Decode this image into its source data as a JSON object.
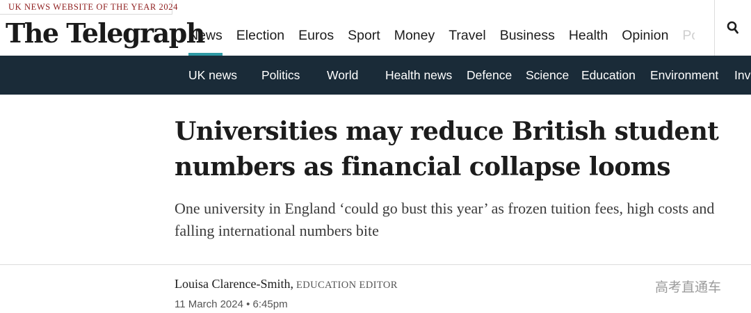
{
  "award_banner": "UK NEWS WEBSITE OF THE YEAR 2024",
  "masthead": "The Telegraph",
  "primary_nav": {
    "items": [
      {
        "label": "News",
        "active": true
      },
      {
        "label": "Election"
      },
      {
        "label": "Euros"
      },
      {
        "label": "Sport"
      },
      {
        "label": "Money"
      },
      {
        "label": "Travel"
      },
      {
        "label": "Business"
      },
      {
        "label": "Health"
      },
      {
        "label": "Opinion"
      },
      {
        "label": "Po"
      }
    ],
    "search_icon": "search-icon"
  },
  "secondary_nav": {
    "items": [
      {
        "label": "UK news"
      },
      {
        "label": "Politics"
      },
      {
        "label": "World"
      },
      {
        "label": "Health news"
      },
      {
        "label": "Defence"
      },
      {
        "label": "Science"
      },
      {
        "label": "Education"
      },
      {
        "label": "Environment"
      },
      {
        "label": "Inv"
      }
    ]
  },
  "article": {
    "headline": "Universities may reduce British student numbers as financial collapse looms",
    "standfirst": "One university in England ‘could go bust this year’ as frozen tuition fees, high costs and falling international numbers bite",
    "author": "Louisa Clarence-Smith,",
    "author_role": "Education Editor",
    "date": "11 March 2024 • 6:45pm"
  },
  "watermark": "高考直通车",
  "colors": {
    "award_red": "#8e1c1c",
    "nav_dark": "#1a2b38",
    "active_underline": "#2f9aa5"
  }
}
